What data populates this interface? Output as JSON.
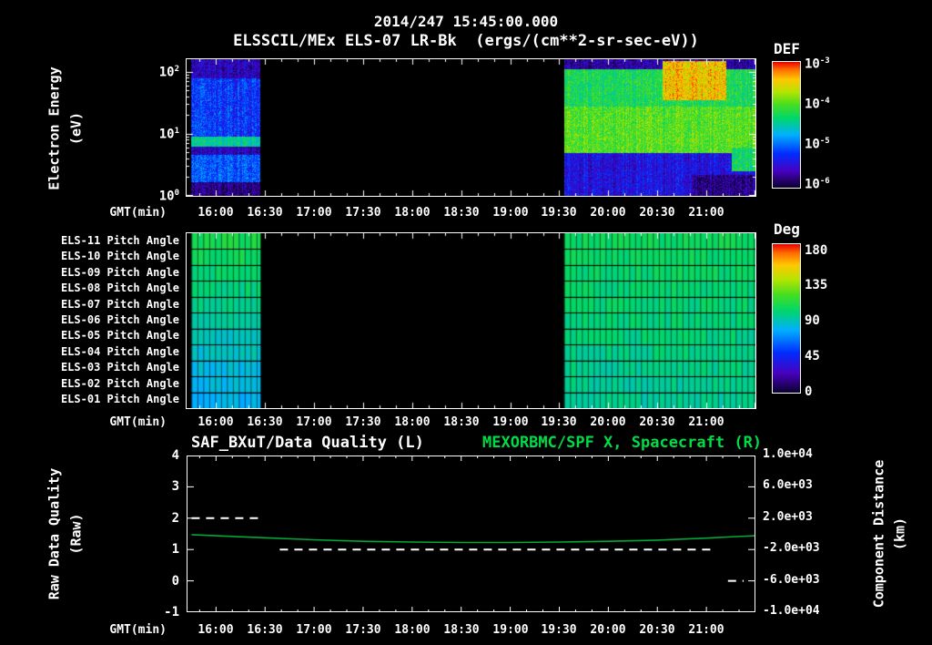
{
  "header": {
    "timestamp_title": "2014/247 15:45:00.000",
    "plot_title": "ELSSCIL/MEx ELS-07 LR-Bk  (ergs/(cm**2-sr-sec-eV))"
  },
  "time_axis": {
    "label": "GMT(min)",
    "ticks": [
      "16:00",
      "16:30",
      "17:00",
      "17:30",
      "18:00",
      "18:30",
      "19:00",
      "19:30",
      "20:00",
      "20:30",
      "21:00"
    ],
    "tick_hours": [
      16.0,
      16.5,
      17.0,
      17.5,
      18.0,
      18.5,
      19.0,
      19.5,
      20.0,
      20.5,
      21.0
    ],
    "range_hours": [
      15.7,
      21.5
    ]
  },
  "spectrogram_panel": {
    "ylabel": "Electron Energy",
    "ylabel_units": "(eV)",
    "yticks": [
      {
        "base": "10",
        "exp": "2",
        "log": 2
      },
      {
        "base": "10",
        "exp": "1",
        "log": 1
      },
      {
        "base": "10",
        "exp": "0",
        "log": 0
      }
    ],
    "colorbar": {
      "label": "DEF",
      "ticks": [
        {
          "base": "10",
          "exp": "-3"
        },
        {
          "base": "10",
          "exp": "-4"
        },
        {
          "base": "10",
          "exp": "-5"
        },
        {
          "base": "10",
          "exp": "-6"
        }
      ]
    }
  },
  "pitch_panel": {
    "row_labels": [
      "ELS-11 Pitch Angle",
      "ELS-10 Pitch Angle",
      "ELS-09 Pitch Angle",
      "ELS-08 Pitch Angle",
      "ELS-07 Pitch Angle",
      "ELS-06 Pitch Angle",
      "ELS-05 Pitch Angle",
      "ELS-04 Pitch Angle",
      "ELS-03 Pitch Angle",
      "ELS-02 Pitch Angle",
      "ELS-01 Pitch Angle"
    ],
    "colorbar": {
      "label": "Deg",
      "ticks": [
        "180",
        "135",
        "90",
        "45",
        "0"
      ]
    }
  },
  "timeseries_panel": {
    "title_left": "SAF_BXuT/Data Quality (L)",
    "title_right": "MEXORBMC/SPF X, Spacecraft (R)",
    "ylabel_left": "Raw Data Quality",
    "ylabel_left_units": "(Raw)",
    "yticks_left": [
      "4",
      "3",
      "2",
      "1",
      "0",
      "-1"
    ],
    "ylabel_right": "Component Distance",
    "ylabel_right_units": "(km)",
    "yticks_right": [
      "1.0e+04",
      "6.0e+03",
      "2.0e+03",
      "-2.0e+03",
      "-6.0e+03",
      "-1.0e+04"
    ]
  },
  "colors": {
    "background": "#000000",
    "text": "#ffffff",
    "accent_green": "#00dc46",
    "series_green": "#00a838",
    "series_white": "#ffffff"
  },
  "chart_data": [
    {
      "type": "heatmap",
      "name": "electron_energy_spectrogram",
      "title": "ELSSCIL/MEx ELS-07 LR-Bk",
      "flux_units": "ergs/(cm**2-sr-sec-eV)",
      "xlabel": "GMT(min)",
      "x_ticks": [
        "16:00",
        "16:30",
        "17:00",
        "17:30",
        "18:00",
        "18:30",
        "19:00",
        "19:30",
        "20:00",
        "20:30",
        "21:00"
      ],
      "ylabel": "Electron Energy (eV)",
      "y_scale": "log",
      "ylim_ev": [
        1,
        160
      ],
      "colorbar_label": "DEF",
      "colorbar_log10_flux_range": [
        -6.4,
        -2.8
      ],
      "data_gaps": [
        [
          "16:27",
          "19:33"
        ]
      ],
      "segments": [
        {
          "start": "15:45",
          "end": "16:27",
          "start_hours": 15.75,
          "end_hours": 16.45,
          "bands": [
            {
              "energy_ev": [
                1,
                1.7
              ],
              "log10_flux": -6.1
            },
            {
              "energy_ev": [
                1.7,
                4.6
              ],
              "log10_flux": -5.25
            },
            {
              "energy_ev": [
                4.6,
                6.4
              ],
              "log10_flux": -5.9
            },
            {
              "energy_ev": [
                6.4,
                9
              ],
              "log10_flux": -4.55
            },
            {
              "energy_ev": [
                9,
                80
              ],
              "log10_flux": -5.4
            },
            {
              "energy_ev": [
                80,
                160
              ],
              "log10_flux": -5.9
            }
          ]
        },
        {
          "start": "19:33",
          "end": "21:30",
          "start_hours": 19.55,
          "end_hours": 21.5,
          "bands": [
            {
              "energy_ev": [
                1,
                5
              ],
              "log10_flux": -5.7
            },
            {
              "energy_ev": [
                5,
                28
              ],
              "log10_flux": -4.0
            },
            {
              "energy_ev": [
                28,
                110
              ],
              "log10_flux": -4.3
            },
            {
              "energy_ev": [
                110,
                160
              ],
              "log10_flux": -6.0
            }
          ],
          "features": [
            {
              "time_hours": [
                20.55,
                21.2
              ],
              "energy_ev": [
                35,
                150
              ],
              "log10_flux": -3.35
            },
            {
              "time_hours": [
                21.25,
                21.5
              ],
              "energy_ev": [
                2.5,
                6
              ],
              "log10_flux": -4.35
            },
            {
              "time_hours": [
                20.85,
                21.5
              ],
              "energy_ev": [
                1,
                2.2
              ],
              "log10_flux": -6.1
            }
          ]
        }
      ]
    },
    {
      "type": "heatmap",
      "name": "pitch_angles",
      "rows": [
        "ELS-11",
        "ELS-10",
        "ELS-09",
        "ELS-08",
        "ELS-07",
        "ELS-06",
        "ELS-05",
        "ELS-04",
        "ELS-03",
        "ELS-02",
        "ELS-01"
      ],
      "value_units": "Deg",
      "value_range": [
        0,
        180
      ],
      "colorbar_ticks": [
        180,
        135,
        90,
        45,
        0
      ],
      "segments": [
        {
          "start": "15:45",
          "end": "16:27",
          "start_hours": 15.75,
          "end_hours": 16.45,
          "row_values_deg": [
            106,
            103,
            100,
            97,
            94,
            91,
            88,
            85,
            82,
            80,
            78
          ]
        },
        {
          "start": "19:33",
          "end": "21:30",
          "start_hours": 19.55,
          "end_hours": 21.5,
          "row_values_deg": [
            102,
            101,
            100,
            99,
            98,
            97,
            96,
            95,
            94,
            93,
            92
          ]
        }
      ]
    },
    {
      "type": "line",
      "name": "quality_and_spacecraft_distance",
      "xlabel": "GMT(min)",
      "ylim_left": [
        -1,
        4
      ],
      "ylim_right": [
        -10000,
        10000
      ],
      "series": [
        {
          "name": "MEXORBMC/SPF X, Spacecraft (R)",
          "axis": "right",
          "color": "#00a838",
          "x_hours": [
            15.75,
            16.0,
            16.5,
            17.0,
            17.5,
            18.0,
            18.5,
            19.0,
            19.5,
            20.0,
            20.5,
            21.0,
            21.3,
            21.5
          ],
          "km": [
            -100,
            -250,
            -500,
            -750,
            -950,
            -1050,
            -1100,
            -1100,
            -1050,
            -950,
            -800,
            -550,
            -350,
            -250
          ]
        },
        {
          "name": "SAF_BXuT/Data Quality (L)",
          "axis": "left",
          "color": "#ffffff",
          "style": "dashed",
          "segments": [
            {
              "x_hours": [
                15.75,
                16.45
              ],
              "quality": 2
            },
            {
              "x_hours": [
                16.65,
                21.05
              ],
              "quality": 1
            },
            {
              "x_hours": [
                21.22,
                21.38
              ],
              "quality": 0
            }
          ]
        }
      ]
    }
  ]
}
